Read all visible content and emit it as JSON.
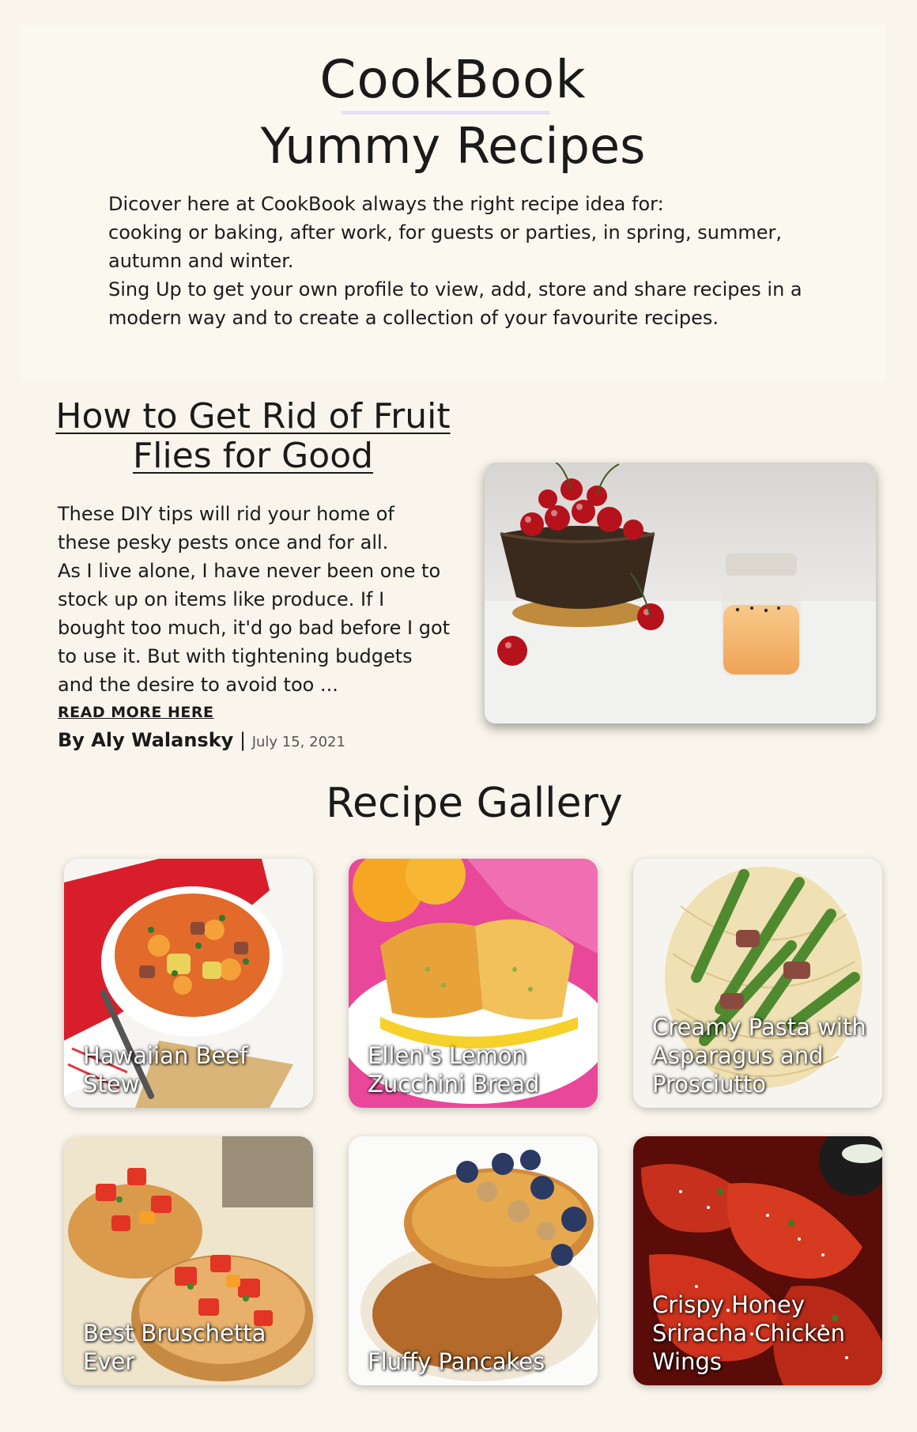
{
  "header": {
    "brand": "CookBook",
    "tagline": "Yummy Recipes"
  },
  "intro": {
    "lines": [
      "Dicover here at CookBook always the right recipe idea for:",
      "cooking or baking, after work, for guests or parties, in spring, summer, autumn and winter.",
      "Sing Up to get your own profile to view, add, store and share recipes in a modern way and to create a collection of your favourite recipes."
    ]
  },
  "article": {
    "title": "How to Get Rid of Fruit Flies for Good",
    "lead": "These DIY tips will rid your home of these pesky pests once and for all.",
    "excerpt": "As I live alone, I have never been one to stock up on items like produce. If I bought too much, it'd go bad before I got to use it. But with tightening budgets and the desire to avoid too ...",
    "read_more": "READ MORE HERE",
    "author": "By Aly Walansky",
    "separator": "|",
    "date": "July 15, 2021"
  },
  "gallery": {
    "title": "Recipe Gallery",
    "cards": [
      {
        "label": "Hawaiian Beef Stew"
      },
      {
        "label": "Ellen's Lemon Zucchini Bread"
      },
      {
        "label": "Creamy Pasta with Asparagus and Prosciutto"
      },
      {
        "label": "Best Bruschetta Ever"
      },
      {
        "label": "Fluffy Pancakes"
      },
      {
        "label": "Crispy Honey Sriracha Chicken Wings"
      }
    ]
  },
  "colors": {
    "background": "#f9f5ec",
    "underline_accent": "#e6e0f4",
    "text": "#1b1b1b"
  }
}
